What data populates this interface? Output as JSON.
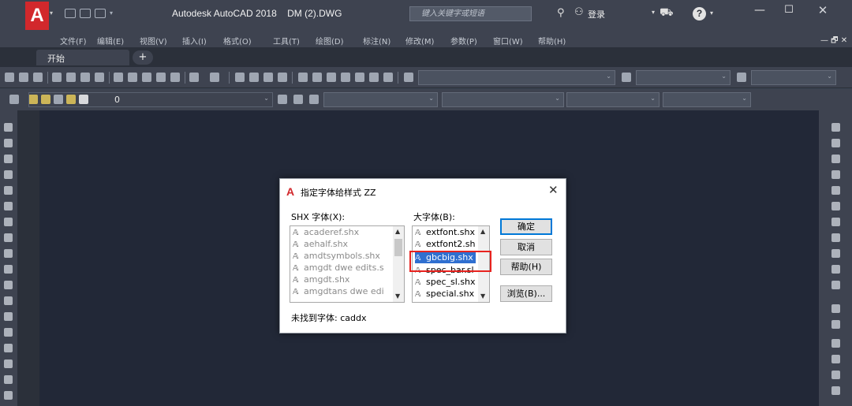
{
  "titlebar": {
    "title": "Autodesk AutoCAD 2018    DM (2).DWG",
    "search_placeholder": "键入关键字或短语",
    "signin": "登录",
    "minimize": "—",
    "maximize": "☐",
    "close": "✕"
  },
  "menubar": {
    "items": [
      "文件(F)",
      "编辑(E)",
      "视图(V)",
      "插入(I)",
      "格式(O)",
      "工具(T)",
      "绘图(D)",
      "标注(N)",
      "修改(M)",
      "参数(P)",
      "窗口(W)",
      "帮助(H)"
    ],
    "mdi_controls": "— 🗗 ✕"
  },
  "tabs": {
    "start": "开始",
    "new": "+"
  },
  "toolbar2": {
    "layer_name": "0"
  },
  "dialog": {
    "title": "指定字体给样式 ZZ",
    "close": "✕",
    "shx_label": "SHX 字体(X):",
    "big_label": "大字体(B):",
    "shx_fonts": [
      "acaderef.shx",
      "aehalf.shx",
      "amdtsymbols.shx",
      "amgdt dwe edits.s",
      "amgdt.shx",
      "amgdtans dwe edi"
    ],
    "big_fonts": [
      "extfont.shx",
      "extfont2.sh",
      "gbcbig.shx",
      "spec_bar.sl",
      "spec_sl.shx",
      "special.shx"
    ],
    "selected_big_font": "gbcbig.shx",
    "buttons": {
      "ok": "确定",
      "cancel": "取消",
      "help": "帮助(H)",
      "browse": "浏览(B)..."
    },
    "not_found": "未找到字体: caddx"
  },
  "colors": {
    "canvas": "#222837",
    "chrome": "#3e4350",
    "selection": "#2f6fd0",
    "highlight_box": "#e8231f",
    "logo": "#d2282c"
  }
}
